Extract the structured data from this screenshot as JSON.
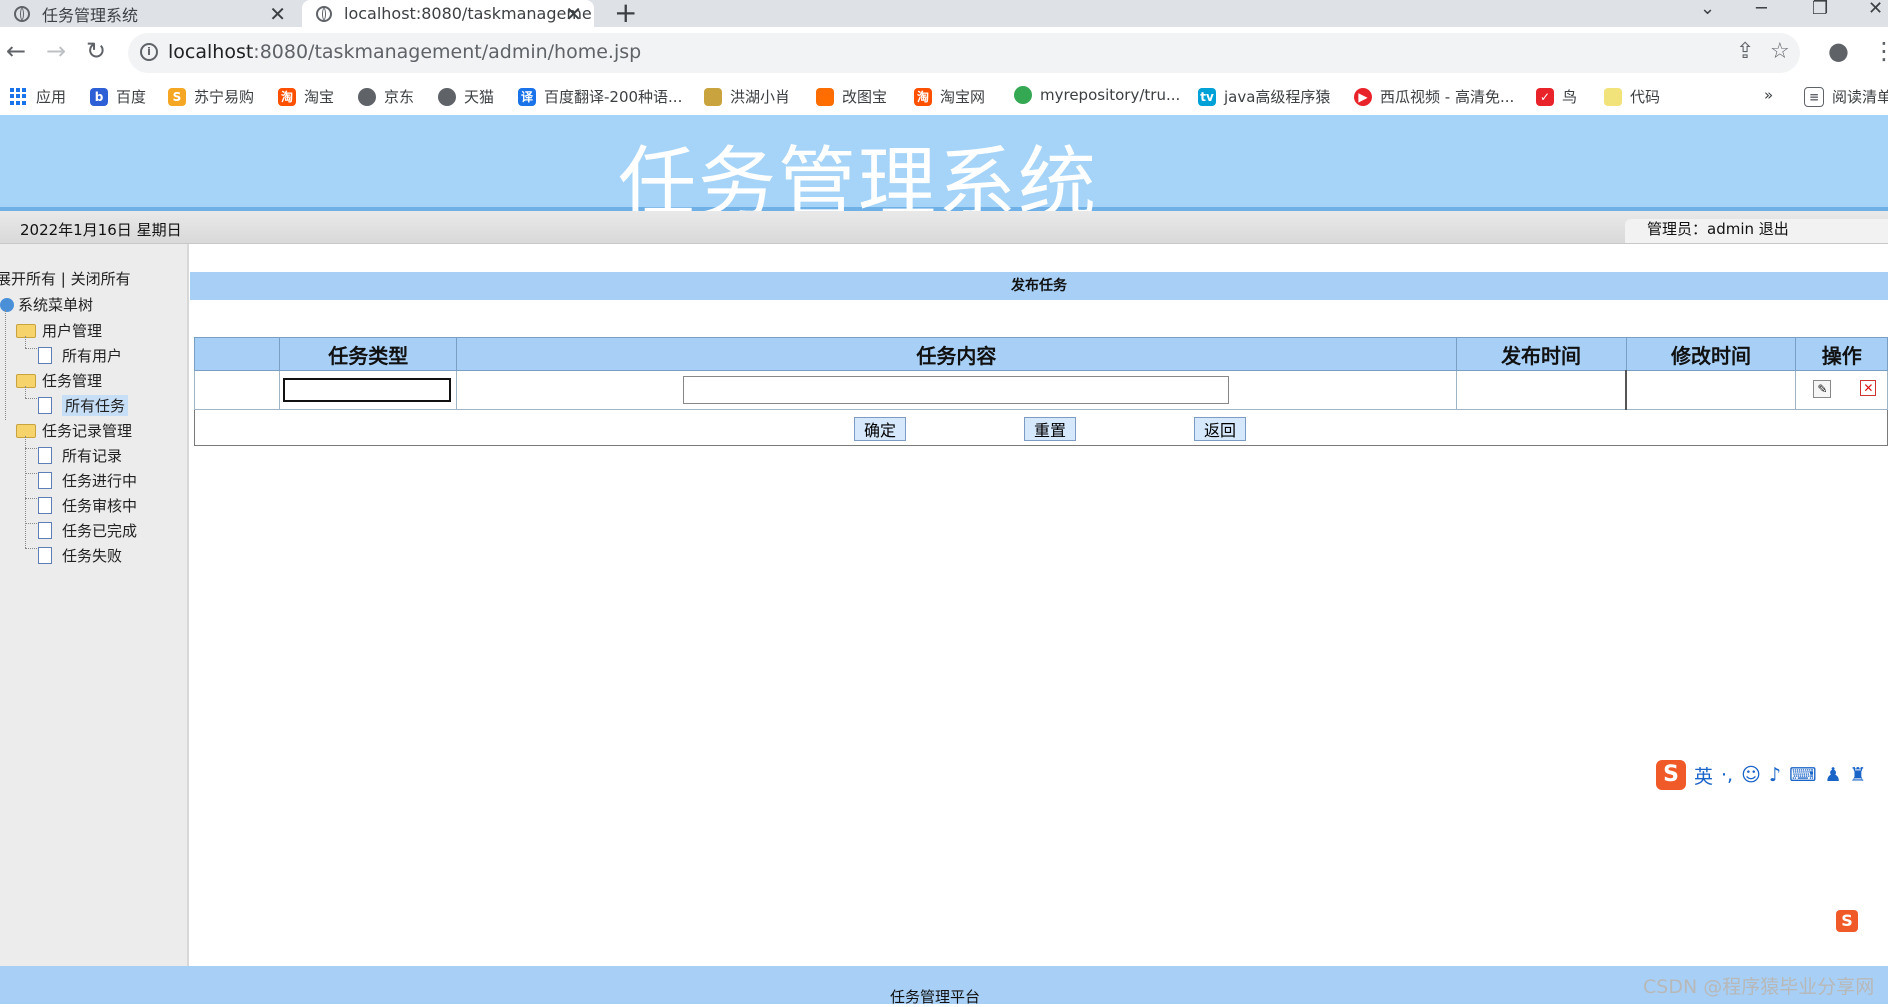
{
  "browser": {
    "tabs": [
      {
        "title": "任务管理系统",
        "active": false
      },
      {
        "title": "localhost:8080/taskmanageme",
        "active": true
      }
    ],
    "url_host": "localhost",
    "url_rest": ":8080/taskmanagement/admin/home.jsp",
    "bookmarks": [
      "应用",
      "百度",
      "苏宁易购",
      "淘宝",
      "京东",
      "天猫",
      "百度翻译-200种语...",
      "洪湖小肖",
      "改图宝",
      "淘宝网",
      "myrepository/tru...",
      "java高级程序猿",
      "西瓜视频 - 高清免...",
      "鸟",
      "代码"
    ],
    "more": "»",
    "reading_list": "阅读清单"
  },
  "app": {
    "title": "任务管理系统",
    "date": "2022年1月16日 星期日",
    "admin_label": "管理员：admin",
    "logout": "退出"
  },
  "sidebar": {
    "expand_all": "展开所有",
    "separator": "|",
    "collapse_all": "关闭所有",
    "root": "系统菜单树",
    "groups": [
      {
        "label": "用户管理",
        "items": [
          "所有用户"
        ]
      },
      {
        "label": "任务管理",
        "items": [
          "所有任务"
        ]
      },
      {
        "label": "任务记录管理",
        "items": [
          "所有记录",
          "任务进行中",
          "任务审核中",
          "任务已完成",
          "任务失败"
        ]
      }
    ],
    "selected": "所有任务"
  },
  "content": {
    "panel_title": "发布任务",
    "columns": [
      "",
      "任务类型",
      "任务内容",
      "发布时间",
      "修改时间",
      "操作"
    ],
    "row": {
      "type_value": "",
      "content_value": "",
      "publish_time": "",
      "modify_time": ""
    },
    "buttons": {
      "confirm": "确定",
      "reset": "重置",
      "back": "返回"
    }
  },
  "ime": {
    "lang": "英"
  },
  "footer": {
    "text": "任务管理平台"
  },
  "watermark": "CSDN @程序猿毕业分享网"
}
